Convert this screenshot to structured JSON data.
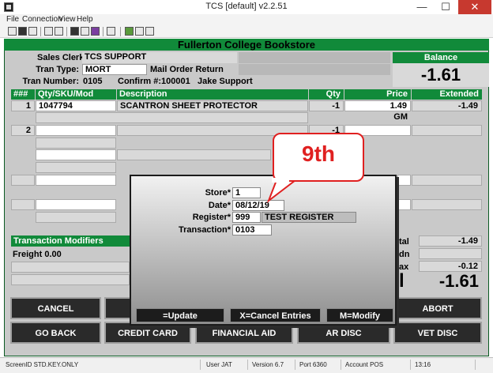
{
  "window": {
    "title": "TCS [default]  v2.2.51",
    "minimize": "—",
    "maximize": "☐",
    "close": "✕"
  },
  "menu": [
    "File",
    "Connection",
    "View",
    "Help"
  ],
  "header": {
    "store": "Fullerton College Bookstore"
  },
  "info": {
    "sales_clerk_label": "Sales Clerk:",
    "sales_clerk": "TCS SUPPORT",
    "tran_type_label": "Tran Type:",
    "tran_type": "MORT",
    "tran_type_desc": "Mail Order Return",
    "tran_number_label": "Tran Number:",
    "tran_number": "0105",
    "confirm_label": "Confirm #:",
    "confirm": "100001",
    "customer": "Jake Support"
  },
  "balance": {
    "label": "Balance",
    "value": "-1.61"
  },
  "grid": {
    "headers": {
      "num": "###",
      "sku": "Qty/SKU/Mod",
      "desc": "Description",
      "qty": "Qty",
      "price": "Price",
      "extended": "Extended"
    },
    "row1": {
      "num": "1",
      "sku": "1047794",
      "desc": "SCANTRON SHEET PROTECTOR",
      "qty": "-1",
      "price": "1.49",
      "extended": "-1.49",
      "note": "GM"
    },
    "row2": {
      "num": "2",
      "qty": "-1"
    }
  },
  "modifiers": {
    "label": "Transaction Modifiers",
    "freight": "Freight 0.00"
  },
  "totals": {
    "subtotal_partial": "tal",
    "subtotal": "-1.49",
    "discount_partial": "dn",
    "tax_partial": "ax",
    "tax": "-0.12",
    "total_partial": "l",
    "total": "-1.61"
  },
  "actions": {
    "cancel": "CANCEL",
    "abort": "ABORT",
    "go_back": "GO BACK",
    "credit_card": "CREDIT CARD",
    "financial_aid": "FINANCIAL AID",
    "ar_disc": "AR DISC",
    "vet_disc": "VET DISC"
  },
  "modal": {
    "store_label": "Store*",
    "store": "1",
    "date_label": "Date*",
    "date": "08/12/19",
    "register_label": "Register*",
    "register": "999",
    "register_name": "TEST REGISTER",
    "transaction_label": "Transaction*",
    "transaction": "0103",
    "update": "=Update",
    "cancel_entries": "X=Cancel Entries",
    "modify": "M=Modify"
  },
  "callout": {
    "text": "9th"
  },
  "status": {
    "screen": "ScreenID STD.KEY.ONLY",
    "user": "User JAT",
    "version": "Version 6.7",
    "port": "Port 6360",
    "account": "Account POS",
    "time": "13:16"
  }
}
